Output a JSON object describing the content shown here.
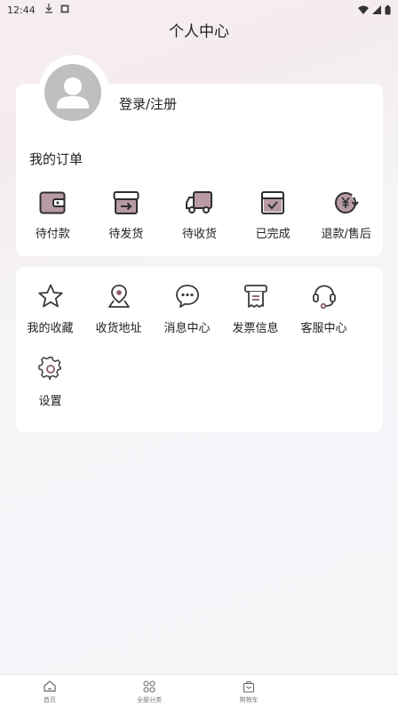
{
  "status_bar": {
    "time": "12:44",
    "icons": [
      "download-icon",
      "notification-icon",
      "wifi-icon",
      "cell-signal-icon",
      "battery-icon"
    ]
  },
  "page_title": "个人中心",
  "profile": {
    "login_label": "登录/注册",
    "avatar_icon": "default-avatar-icon"
  },
  "orders": {
    "title": "我的订单",
    "items": [
      {
        "label": "待付款",
        "icon": "wallet-icon"
      },
      {
        "label": "待发货",
        "icon": "box-arrow-icon"
      },
      {
        "label": "待收货",
        "icon": "truck-icon"
      },
      {
        "label": "已完成",
        "icon": "check-box-icon"
      },
      {
        "label": "退款/售后",
        "icon": "yen-refund-icon"
      }
    ]
  },
  "services": {
    "items": [
      {
        "label": "我的收藏",
        "icon": "star-icon"
      },
      {
        "label": "收货地址",
        "icon": "location-icon"
      },
      {
        "label": "消息中心",
        "icon": "chat-bubble-icon"
      },
      {
        "label": "发票信息",
        "icon": "invoice-icon"
      },
      {
        "label": "客服中心",
        "icon": "headset-icon"
      },
      {
        "label": "设置",
        "icon": "gear-icon"
      }
    ]
  },
  "tab_bar": {
    "tabs": [
      {
        "label": "首页",
        "icon": "home-icon"
      },
      {
        "label": "全部分类",
        "icon": "grid-icon"
      },
      {
        "label": "购物车",
        "icon": "cart-bag-icon"
      }
    ]
  },
  "colors": {
    "accent_icon": "#8a5a6a",
    "icon_dark": "#3a3a3a",
    "avatar_bg": "#bfbfbf"
  }
}
